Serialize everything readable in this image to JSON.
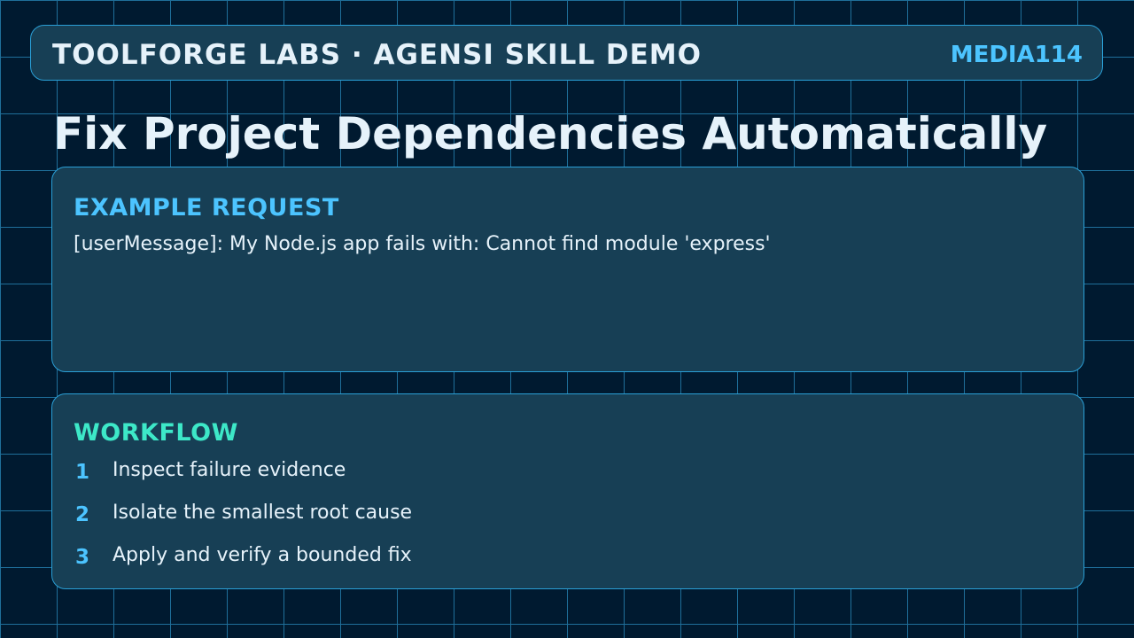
{
  "header": {
    "brand": "TOOLFORGE LABS · AGENSI SKILL DEMO",
    "media_id": "MEDIA114"
  },
  "title": "Fix Project Dependencies Automatically",
  "request_card": {
    "heading": "EXAMPLE REQUEST",
    "text": "[userMessage]: My Node.js app fails with: Cannot find module 'express'"
  },
  "workflow_card": {
    "heading": "WORKFLOW",
    "steps": [
      {
        "number": "1",
        "label": "Inspect failure evidence"
      },
      {
        "number": "2",
        "label": "Isolate the smallest root cause"
      },
      {
        "number": "3",
        "label": "Apply and verify a bounded fix"
      }
    ]
  },
  "colors": {
    "background": "#001a30",
    "grid": "#1f6f9a",
    "panel": "#173f55",
    "border": "#2a9fd6",
    "accent_blue": "#4cc4ff",
    "accent_teal": "#3de8c8",
    "text": "#e6f2fa"
  }
}
